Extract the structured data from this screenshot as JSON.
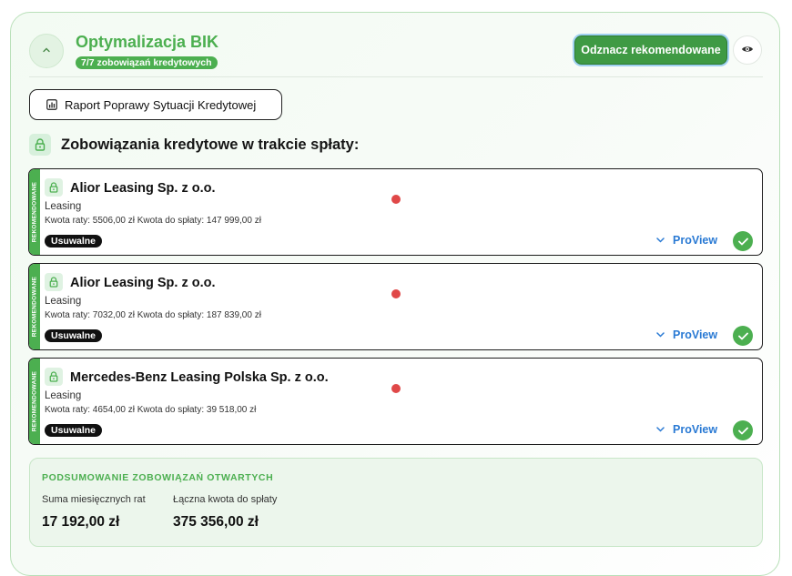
{
  "header": {
    "title": "Optymalizacja BIK",
    "count_badge": "7/7 zobowiązań kredytowych",
    "unmark_button": "Odznacz rekomendowane",
    "collapse_icon": "chevron-up-icon",
    "eye_icon": "eye-icon"
  },
  "report_button": {
    "label": "Raport Poprawy Sytuacji Kredytowej",
    "icon": "bar-chart-icon"
  },
  "section": {
    "title": "Zobowiązania kredytowe w trakcie spłaty:",
    "icon": "lock-icon"
  },
  "cards": [
    {
      "ribbon": "REKOMENDOWANE",
      "name": "Alior Leasing Sp. z o.o.",
      "type": "Leasing",
      "amounts": "Kwota raty: 5506,00 zł  Kwota do spłaty: 147 999,00 zł",
      "badge": "Usuwalne",
      "proview": "ProView"
    },
    {
      "ribbon": "REKOMENDOWANE",
      "name": "Alior Leasing Sp. z o.o.",
      "type": "Leasing",
      "amounts": "Kwota raty: 7032,00 zł  Kwota do spłaty: 187 839,00 zł",
      "badge": "Usuwalne",
      "proview": "ProView"
    },
    {
      "ribbon": "REKOMENDOWANE",
      "name": "Mercedes-Benz Leasing Polska Sp. z o.o.",
      "type": "Leasing",
      "amounts": "Kwota raty: 4654,00 zł  Kwota do spłaty: 39 518,00 zł",
      "badge": "Usuwalne",
      "proview": "ProView"
    }
  ],
  "summary": {
    "title": "PODSUMOWANIE ZOBOWIĄZAŃ OTWARTYCH",
    "monthly_label": "Suma miesięcznych rat",
    "monthly_value": "17 192,00 zł",
    "total_label": "Łączna kwota do spłaty",
    "total_value": "375 356,00 zł"
  },
  "colors": {
    "accent_green": "#4caf50",
    "status_red": "#e04848",
    "link_blue": "#2a7ad4"
  }
}
